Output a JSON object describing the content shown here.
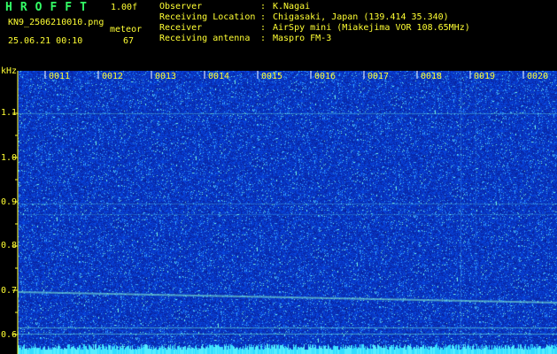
{
  "header": {
    "app_title": "HROFFT",
    "version": "1.00f",
    "filename": "KN9_2506210010.png",
    "meteor_label": "meteor",
    "datetime": "25.06.21 00:10",
    "meteor_count": "67"
  },
  "info": [
    {
      "key": "Observer",
      "value": "K.Nagai"
    },
    {
      "key": "Receiving Location",
      "value": "Chigasaki, Japan (139.414 35.340)"
    },
    {
      "key": "Receiver",
      "value": "AirSpy mini (Miakejima VOR 108.65MHz)"
    },
    {
      "key": "Receiving antenna",
      "value": "Maspro FM-3"
    }
  ],
  "axis": {
    "unit": "kHz",
    "y_labels": [
      "1.1",
      "1.0",
      "0.9",
      "0.8",
      "0.7",
      "0.6"
    ],
    "time_labels": [
      "0011",
      "0012",
      "0013",
      "0014",
      "0015",
      "0016",
      "0017",
      "0018",
      "0019",
      "0020"
    ]
  },
  "colors": {
    "background": "#000000",
    "label": "#ffff33",
    "title": "#33ff66",
    "spectrum_base": "#0a1fa8"
  }
}
